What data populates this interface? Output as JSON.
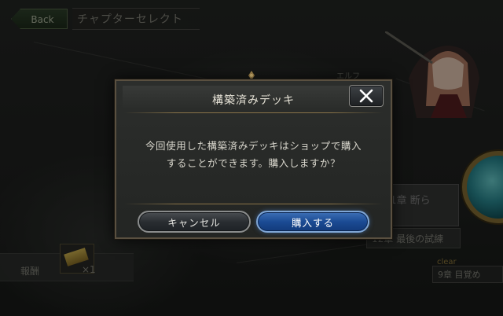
{
  "top_bar": {
    "back_label": "Back",
    "chapter_select_label": "チャプターセレクト"
  },
  "background": {
    "class_label": "エルフ",
    "chapter_tab_label": "11章 断ら",
    "chapter_row_label": "12章 最後の試練",
    "clear_label": "clear",
    "clear_row_label": "9章 目覚め",
    "reward_label": "報酬",
    "reward_count": "×1"
  },
  "dialog": {
    "title": "構築済みデッキ",
    "message_line1": "今回使用した構築済みデッキはショップで購入",
    "message_line2": "することができます。購入しますか？",
    "cancel_label": "キャンセル",
    "buy_label": "購入する"
  },
  "colors": {
    "dialog_border": "#5a5040",
    "buy_button": "#1b4b94",
    "cancel_button": "#2a2e32",
    "back_button": "#32452e"
  }
}
